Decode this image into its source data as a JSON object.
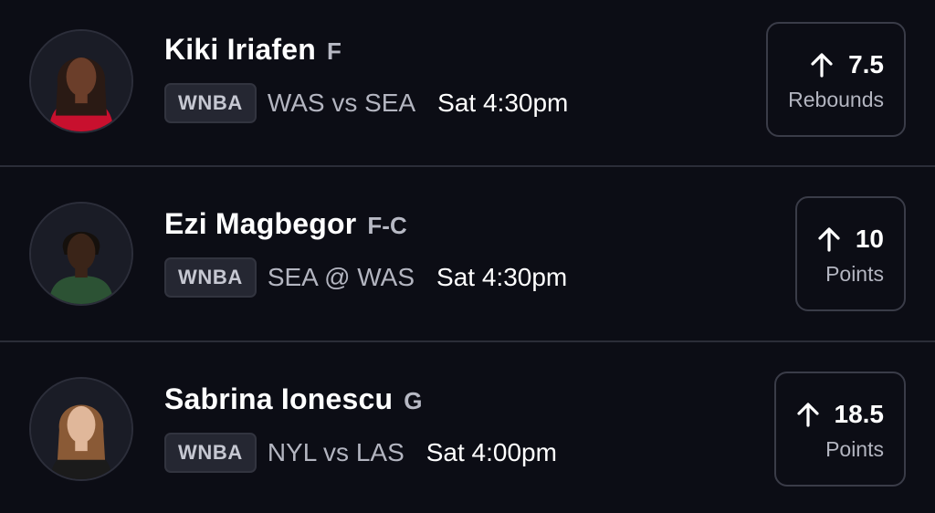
{
  "players": [
    {
      "name": "Kiki Iriafen",
      "position": "F",
      "league": "WNBA",
      "matchup": "WAS vs SEA",
      "time": "Sat 4:30pm",
      "direction_icon": "arrow-up-icon",
      "line": "7.5",
      "stat": "Rebounds",
      "avatar_colors": {
        "skin": "#6b3e2a",
        "hair": "#2a1a14",
        "jersey": "#c8102e"
      }
    },
    {
      "name": "Ezi Magbegor",
      "position": "F-C",
      "league": "WNBA",
      "matchup": "SEA @ WAS",
      "time": "Sat 4:30pm",
      "direction_icon": "arrow-up-icon",
      "line": "10",
      "stat": "Points",
      "avatar_colors": {
        "skin": "#3a2418",
        "hair": "#15100c",
        "jersey": "#2c5234"
      }
    },
    {
      "name": "Sabrina Ionescu",
      "position": "G",
      "league": "WNBA",
      "matchup": "NYL vs LAS",
      "time": "Sat 4:00pm",
      "direction_icon": "arrow-up-icon",
      "line": "18.5",
      "stat": "Points",
      "avatar_colors": {
        "skin": "#e0b79a",
        "hair": "#8a5a36",
        "jersey": "#1b1b1b"
      }
    }
  ]
}
